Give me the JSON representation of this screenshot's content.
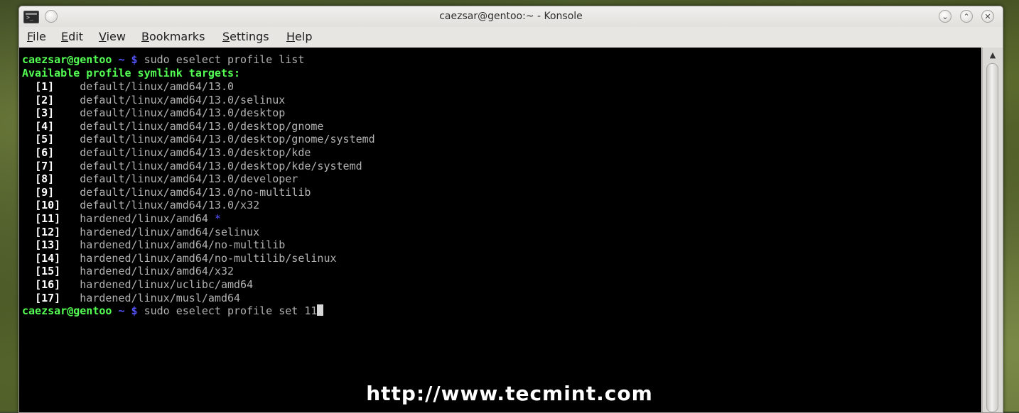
{
  "window": {
    "title": "caezsar@gentoo:~ - Konsole",
    "buttons": {
      "minimize": "⌄",
      "maximize": "⌃",
      "close": "✕"
    }
  },
  "menu": {
    "items": [
      {
        "label": "File",
        "accel": "F",
        "rest": "ile"
      },
      {
        "label": "Edit",
        "accel": "E",
        "rest": "dit"
      },
      {
        "label": "View",
        "accel": "V",
        "rest": "iew"
      },
      {
        "label": "Bookmarks",
        "accel": "B",
        "rest": "ookmarks"
      },
      {
        "label": "Settings",
        "accel": "S",
        "rest": "ettings"
      },
      {
        "label": "Help",
        "accel": "H",
        "rest": "elp"
      }
    ]
  },
  "terminal": {
    "prompt_user": "caezsar@gentoo",
    "prompt_dir": "~",
    "prompt_sym": "$",
    "command1": "sudo eselect profile list",
    "header": "Available profile symlink targets:",
    "profiles": [
      {
        "num": "[1]",
        "path": "default/linux/amd64/13.0",
        "selected": ""
      },
      {
        "num": "[2]",
        "path": "default/linux/amd64/13.0/selinux",
        "selected": ""
      },
      {
        "num": "[3]",
        "path": "default/linux/amd64/13.0/desktop",
        "selected": ""
      },
      {
        "num": "[4]",
        "path": "default/linux/amd64/13.0/desktop/gnome",
        "selected": ""
      },
      {
        "num": "[5]",
        "path": "default/linux/amd64/13.0/desktop/gnome/systemd",
        "selected": ""
      },
      {
        "num": "[6]",
        "path": "default/linux/amd64/13.0/desktop/kde",
        "selected": ""
      },
      {
        "num": "[7]",
        "path": "default/linux/amd64/13.0/desktop/kde/systemd",
        "selected": ""
      },
      {
        "num": "[8]",
        "path": "default/linux/amd64/13.0/developer",
        "selected": ""
      },
      {
        "num": "[9]",
        "path": "default/linux/amd64/13.0/no-multilib",
        "selected": ""
      },
      {
        "num": "[10]",
        "path": "default/linux/amd64/13.0/x32",
        "selected": ""
      },
      {
        "num": "[11]",
        "path": "hardened/linux/amd64",
        "selected": "*"
      },
      {
        "num": "[12]",
        "path": "hardened/linux/amd64/selinux",
        "selected": ""
      },
      {
        "num": "[13]",
        "path": "hardened/linux/amd64/no-multilib",
        "selected": ""
      },
      {
        "num": "[14]",
        "path": "hardened/linux/amd64/no-multilib/selinux",
        "selected": ""
      },
      {
        "num": "[15]",
        "path": "hardened/linux/amd64/x32",
        "selected": ""
      },
      {
        "num": "[16]",
        "path": "hardened/linux/uclibc/amd64",
        "selected": ""
      },
      {
        "num": "[17]",
        "path": "hardened/linux/musl/amd64",
        "selected": ""
      }
    ],
    "command2": "sudo eselect profile set 11"
  },
  "scrollbar": {
    "up_arrow": "▲"
  },
  "watermark": "http://www.tecmint.com",
  "colors": {
    "prompt_green": "#54ff54",
    "prompt_blue": "#5454ff",
    "text_gray": "#b2b2b2",
    "terminal_bg": "#000000"
  }
}
